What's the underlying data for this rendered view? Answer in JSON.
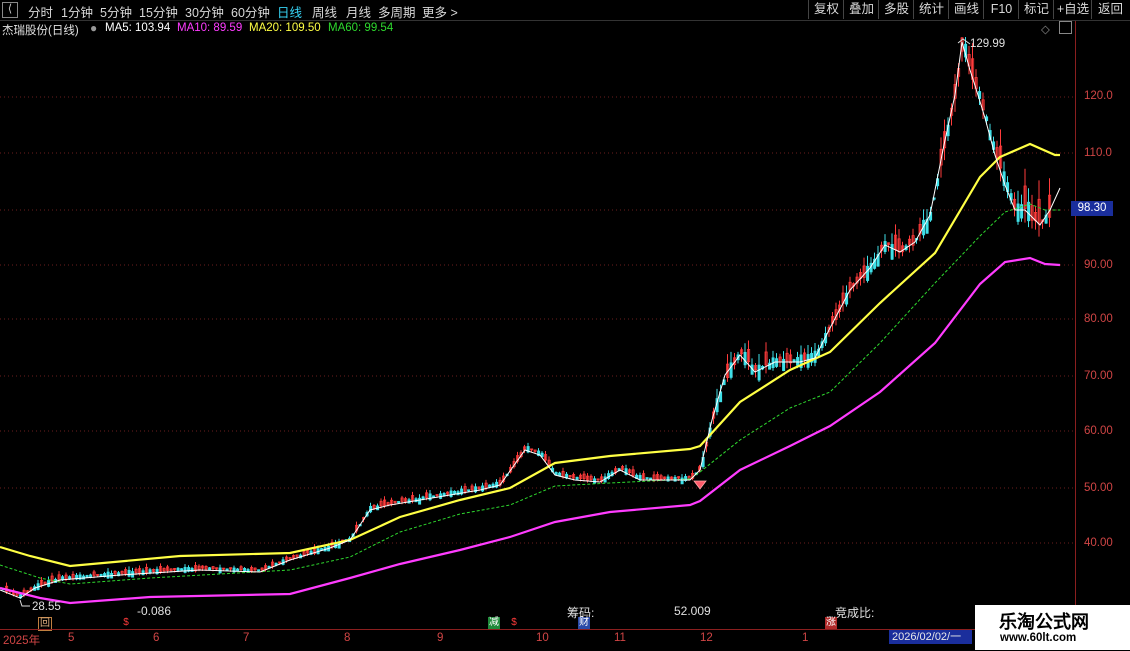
{
  "toolbar": {
    "back_glyph": "⟨",
    "periods": [
      "分时",
      "1分钟",
      "5分钟",
      "15分钟",
      "30分钟",
      "60分钟",
      "日线",
      "周线",
      "月线",
      "多周期",
      "更多 >"
    ],
    "active_period": "日线",
    "buttons": [
      "复权",
      "叠加",
      "多股",
      "统计",
      "画线",
      "F10",
      "标记",
      "+自选",
      "返回"
    ]
  },
  "info": {
    "title": "杰瑞股份(日线)",
    "ma5": "MA5: 103.94",
    "ma10": "MA10: 89.59",
    "ma20": "MA20: 109.50",
    "ma60": "MA60: 99.54"
  },
  "colors": {
    "ma5": "#ffffff",
    "ma10": "#ff3cff",
    "ma20": "#ffff44",
    "ma60": "#2ed82e",
    "up": "#ff3b3b",
    "down": "#3fe0e8",
    "axis": "#d04545"
  },
  "chart_data": {
    "type": "candlestick",
    "y_ticks": [
      "120.0",
      "110.0",
      "90.00",
      "80.00",
      "70.00",
      "60.00",
      "50.00",
      "40.00"
    ],
    "current_price": "98.30",
    "high_label": "129.99",
    "low_label": "28.55",
    "x_labels": [
      "2025年",
      "5",
      "6",
      "7",
      "8",
      "9",
      "10",
      "11",
      "12",
      "1"
    ],
    "cursor_date": "2026/02/02/一",
    "price_range": [
      28.55,
      129.99
    ]
  },
  "status": {
    "value1": "-0.086",
    "chips_label": "筹码:",
    "chips_value": "52.009",
    "bid_label": "竞成比:"
  },
  "markers": [
    {
      "text": "回",
      "color": "#e0b080"
    },
    {
      "text": "$",
      "color": "#ff3b3b"
    },
    {
      "text": "减",
      "color": "#fff"
    },
    {
      "text": "$",
      "color": "#ff3b3b"
    },
    {
      "text": "财",
      "color": "#fff"
    },
    {
      "text": "涨",
      "color": "#fff"
    }
  ],
  "watermark": {
    "title": "乐淘公式网",
    "url": "www.60lt.com"
  }
}
